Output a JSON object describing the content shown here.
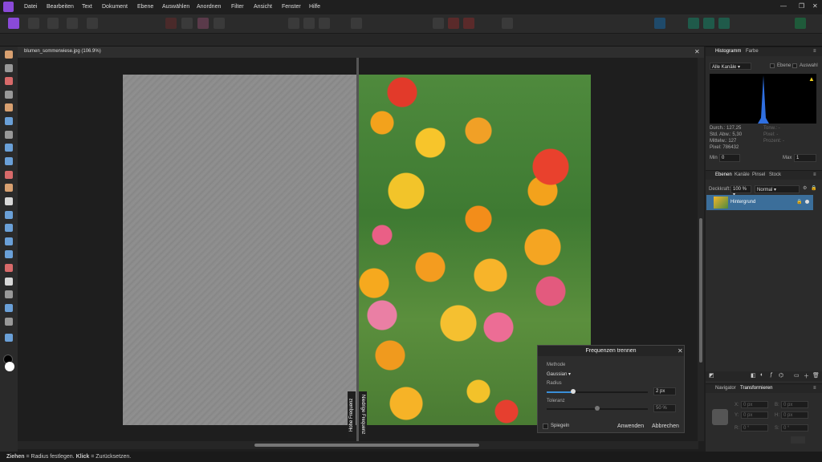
{
  "menu": [
    "Datei",
    "Bearbeiten",
    "Text",
    "Dokument",
    "Ebene",
    "Auswählen",
    "Anordnen",
    "Filter",
    "Ansicht",
    "Fenster",
    "Hilfe"
  ],
  "document": {
    "tab_title": "blumen_sommerwiese.jpg (106.9%)"
  },
  "canvas": {
    "high_freq_label": "Hohe Frequenz",
    "low_freq_label": "Niedrige Frequenz"
  },
  "histogram": {
    "tabs": [
      "Histogramm",
      "Farbe"
    ],
    "channel": "Alle Kanäle",
    "layer_label": "Ebene",
    "selection_label": "Auswahl",
    "stats_left": [
      "Durch.: 127,25",
      "Std. Abw.: 5,30",
      "Mittelw.: 127",
      "Pixel: 786432"
    ],
    "stats_right": [
      "Tonw.: -",
      "Pixel: -",
      "Prozent: -"
    ],
    "min_label": "Min",
    "min_value": "0",
    "max_label": "Max",
    "max_value": "1"
  },
  "layers": {
    "tabs": [
      "Ebenen",
      "Kanäle",
      "Pinsel",
      "Stock"
    ],
    "opacity_label": "Deckkraft:",
    "opacity_value": "100 %",
    "blend_mode": "Normal",
    "layer_name": "Hintergrund"
  },
  "transform": {
    "tabs": [
      "Navigator",
      "Transformieren"
    ],
    "x_label": "X:",
    "x_value": "0 px",
    "y_label": "Y:",
    "y_value": "0 px",
    "w_label": "B:",
    "w_value": "0 px",
    "h_label": "H:",
    "h_value": "0 px",
    "r_label": "R:",
    "r_value": "0 °",
    "s_label": "S:",
    "s_value": "0 °"
  },
  "dialog": {
    "title": "Frequenzen trennen",
    "method_label": "Methode",
    "method_value": "Gaussian",
    "radius_label": "Radius",
    "radius_value": "2 px",
    "radius_level": 0.26,
    "tolerance_label": "Toleranz",
    "tolerance_value": "50 %",
    "tolerance_level": 0.5,
    "mirror_label": "Spiegeln",
    "apply_label": "Anwenden",
    "cancel_label": "Abbrechen"
  },
  "status": {
    "bold1": "Ziehen",
    "text1": " = Radius festlegen. ",
    "bold2": "Klick",
    "text2": " = Zurücksetzen."
  },
  "colors": {
    "accent": "#3a8fd8",
    "selected_layer": "#3b6e9a",
    "histogram_bg": "#000000",
    "histogram_curve": "#2f6fe0"
  }
}
